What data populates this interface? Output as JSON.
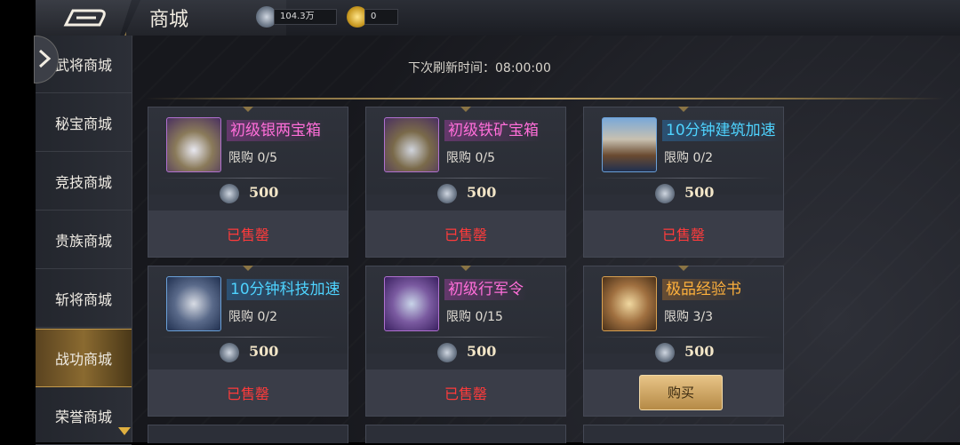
{
  "header": {
    "title": "商城",
    "silver_value": "104.3万",
    "gold_value": "0"
  },
  "sidebar": {
    "items": [
      {
        "label": "武将商城"
      },
      {
        "label": "秘宝商城"
      },
      {
        "label": "竞技商城"
      },
      {
        "label": "贵族商城"
      },
      {
        "label": "斩将商城"
      },
      {
        "label": "战功商城",
        "active": true
      },
      {
        "label": "荣誉商城"
      }
    ]
  },
  "main": {
    "refresh_text": "下次刷新时间：08:00:00",
    "cards": [
      {
        "name": "初级银两宝箱",
        "limit": "限购 0/5",
        "price": "500",
        "status": "已售罄"
      },
      {
        "name": "初级铁矿宝箱",
        "limit": "限购 0/5",
        "price": "500",
        "status": "已售罄"
      },
      {
        "name": "10分钟建筑加速",
        "limit": "限购 0/2",
        "price": "500",
        "status": "已售罄"
      },
      {
        "name": "10分钟科技加速",
        "limit": "限购 0/2",
        "price": "500",
        "status": "已售罄"
      },
      {
        "name": "初级行军令",
        "limit": "限购 0/15",
        "price": "500",
        "status": "已售罄"
      },
      {
        "name": "极品经验书",
        "limit": "限购 3/3",
        "price": "500",
        "buy_label": "购买"
      }
    ]
  },
  "colors": {
    "name_pink": "#ff6ed9",
    "name_cyan": "#4ed3ff",
    "name_orange": "#ffb13c",
    "sold_red": "#ff3b3b",
    "active_gold": "#8a6a30"
  },
  "icons": [
    "back-arrow-icon",
    "silver-coin-icon",
    "gold-coin-icon",
    "chevron-right-icon",
    "chevron-down-icon"
  ]
}
